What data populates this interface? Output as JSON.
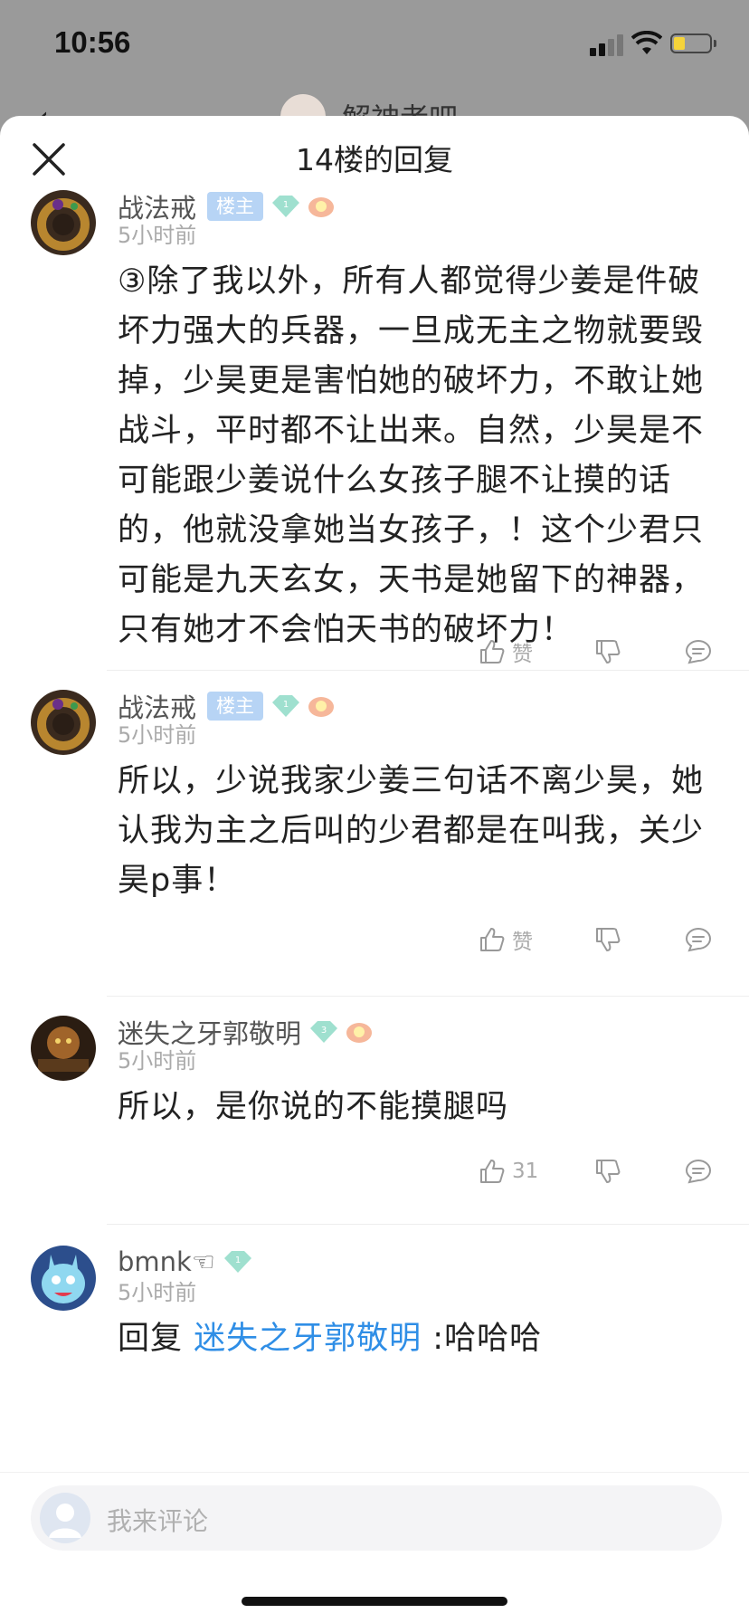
{
  "status_bar": {
    "time": "10:56"
  },
  "background_nav": {
    "title": "解神者吧"
  },
  "sheet": {
    "title": "14楼的回复"
  },
  "comments": [
    {
      "username": "战法戒",
      "host_badge": "楼主",
      "level": "1",
      "time": "5小时前",
      "content": "③除了我以外，所有人都觉得少姜是件破坏力强大的兵器，一旦成无主之物就要毁掉，少昊更是害怕她的破坏力，不敢让她战斗，平时都不让出来。自然，少昊是不可能跟少姜说什么女孩子腿不让摸的话的，他就没拿她当女孩子，！这个少君只可能是九天玄女，天书是她留下的神器，只有她才不会怕天书的破坏力！",
      "like_label": "赞"
    },
    {
      "username": "战法戒",
      "host_badge": "楼主",
      "level": "1",
      "time": "5小时前",
      "content": "所以，少说我家少姜三句话不离少昊，她认我为主之后叫的少君都是在叫我，关少昊p事！",
      "like_label": "赞"
    },
    {
      "username": "迷失之牙郭敬明",
      "level": "3",
      "time": "5小时前",
      "content": "所以，是你说的不能摸腿吗",
      "like_label": "31"
    },
    {
      "username": "bmnk☜",
      "level": "1",
      "time": "5小时前",
      "reply_prefix": "回复 ",
      "reply_target": "迷失之牙郭敬明",
      "reply_text": " :哈哈哈"
    }
  ],
  "comment_input": {
    "placeholder": "我来评论"
  },
  "colors": {
    "link": "#2f8ee6",
    "host_badge": "#b7d4f5",
    "level_gem": "#9fe0cf"
  }
}
